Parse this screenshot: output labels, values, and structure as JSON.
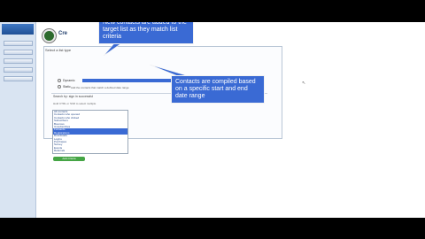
{
  "header": {
    "title": "Cre"
  },
  "panel": {
    "title": "Select a list type",
    "dynamic_label": "Dynamic",
    "static_label": "Static",
    "static_description": "Add the contacts that match a defined date range"
  },
  "search": {
    "label": "Search by: sign in successful",
    "hint": "Hold CTRL or Shift to select multiple"
  },
  "list_items": [
    "All contacts",
    "Contacts who opened",
    "Contacts who clicked",
    "Subscribers",
    "Bounces",
    "Unsubscribes",
    "Forwards",
    "Registrations",
    "Downloads",
    "Logins",
    "Purchases",
    "Survey",
    "Events",
    "Referrals"
  ],
  "callouts": {
    "dynamic": "New contacts are added to the target list as they match list criteria",
    "static": "Contacts are compiled based on a specific start and end date range"
  },
  "apply_button": {
    "label": "Add criteria"
  },
  "colors": {
    "callout_bg": "#3a6ad4",
    "sidebar_bg": "#d9e4f2",
    "apply_bg": "#45a545"
  }
}
